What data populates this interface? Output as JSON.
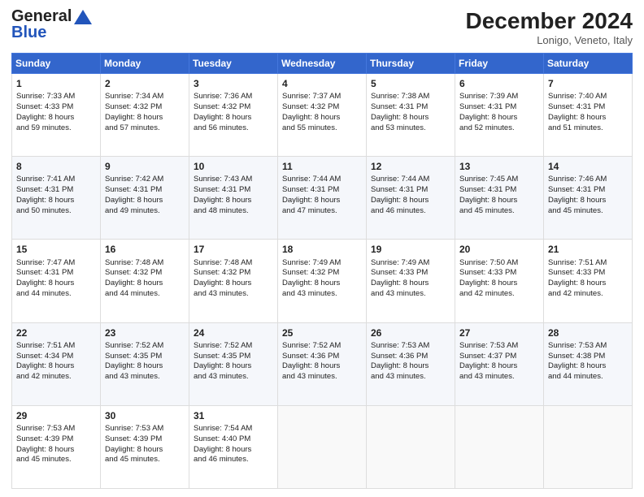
{
  "header": {
    "logo_line1": "General",
    "logo_line2": "Blue",
    "month": "December 2024",
    "location": "Lonigo, Veneto, Italy"
  },
  "weekdays": [
    "Sunday",
    "Monday",
    "Tuesday",
    "Wednesday",
    "Thursday",
    "Friday",
    "Saturday"
  ],
  "weeks": [
    [
      {
        "day": "1",
        "lines": [
          "Sunrise: 7:33 AM",
          "Sunset: 4:33 PM",
          "Daylight: 8 hours",
          "and 59 minutes."
        ]
      },
      {
        "day": "2",
        "lines": [
          "Sunrise: 7:34 AM",
          "Sunset: 4:32 PM",
          "Daylight: 8 hours",
          "and 57 minutes."
        ]
      },
      {
        "day": "3",
        "lines": [
          "Sunrise: 7:36 AM",
          "Sunset: 4:32 PM",
          "Daylight: 8 hours",
          "and 56 minutes."
        ]
      },
      {
        "day": "4",
        "lines": [
          "Sunrise: 7:37 AM",
          "Sunset: 4:32 PM",
          "Daylight: 8 hours",
          "and 55 minutes."
        ]
      },
      {
        "day": "5",
        "lines": [
          "Sunrise: 7:38 AM",
          "Sunset: 4:31 PM",
          "Daylight: 8 hours",
          "and 53 minutes."
        ]
      },
      {
        "day": "6",
        "lines": [
          "Sunrise: 7:39 AM",
          "Sunset: 4:31 PM",
          "Daylight: 8 hours",
          "and 52 minutes."
        ]
      },
      {
        "day": "7",
        "lines": [
          "Sunrise: 7:40 AM",
          "Sunset: 4:31 PM",
          "Daylight: 8 hours",
          "and 51 minutes."
        ]
      }
    ],
    [
      {
        "day": "8",
        "lines": [
          "Sunrise: 7:41 AM",
          "Sunset: 4:31 PM",
          "Daylight: 8 hours",
          "and 50 minutes."
        ]
      },
      {
        "day": "9",
        "lines": [
          "Sunrise: 7:42 AM",
          "Sunset: 4:31 PM",
          "Daylight: 8 hours",
          "and 49 minutes."
        ]
      },
      {
        "day": "10",
        "lines": [
          "Sunrise: 7:43 AM",
          "Sunset: 4:31 PM",
          "Daylight: 8 hours",
          "and 48 minutes."
        ]
      },
      {
        "day": "11",
        "lines": [
          "Sunrise: 7:44 AM",
          "Sunset: 4:31 PM",
          "Daylight: 8 hours",
          "and 47 minutes."
        ]
      },
      {
        "day": "12",
        "lines": [
          "Sunrise: 7:44 AM",
          "Sunset: 4:31 PM",
          "Daylight: 8 hours",
          "and 46 minutes."
        ]
      },
      {
        "day": "13",
        "lines": [
          "Sunrise: 7:45 AM",
          "Sunset: 4:31 PM",
          "Daylight: 8 hours",
          "and 45 minutes."
        ]
      },
      {
        "day": "14",
        "lines": [
          "Sunrise: 7:46 AM",
          "Sunset: 4:31 PM",
          "Daylight: 8 hours",
          "and 45 minutes."
        ]
      }
    ],
    [
      {
        "day": "15",
        "lines": [
          "Sunrise: 7:47 AM",
          "Sunset: 4:31 PM",
          "Daylight: 8 hours",
          "and 44 minutes."
        ]
      },
      {
        "day": "16",
        "lines": [
          "Sunrise: 7:48 AM",
          "Sunset: 4:32 PM",
          "Daylight: 8 hours",
          "and 44 minutes."
        ]
      },
      {
        "day": "17",
        "lines": [
          "Sunrise: 7:48 AM",
          "Sunset: 4:32 PM",
          "Daylight: 8 hours",
          "and 43 minutes."
        ]
      },
      {
        "day": "18",
        "lines": [
          "Sunrise: 7:49 AM",
          "Sunset: 4:32 PM",
          "Daylight: 8 hours",
          "and 43 minutes."
        ]
      },
      {
        "day": "19",
        "lines": [
          "Sunrise: 7:49 AM",
          "Sunset: 4:33 PM",
          "Daylight: 8 hours",
          "and 43 minutes."
        ]
      },
      {
        "day": "20",
        "lines": [
          "Sunrise: 7:50 AM",
          "Sunset: 4:33 PM",
          "Daylight: 8 hours",
          "and 42 minutes."
        ]
      },
      {
        "day": "21",
        "lines": [
          "Sunrise: 7:51 AM",
          "Sunset: 4:33 PM",
          "Daylight: 8 hours",
          "and 42 minutes."
        ]
      }
    ],
    [
      {
        "day": "22",
        "lines": [
          "Sunrise: 7:51 AM",
          "Sunset: 4:34 PM",
          "Daylight: 8 hours",
          "and 42 minutes."
        ]
      },
      {
        "day": "23",
        "lines": [
          "Sunrise: 7:52 AM",
          "Sunset: 4:35 PM",
          "Daylight: 8 hours",
          "and 43 minutes."
        ]
      },
      {
        "day": "24",
        "lines": [
          "Sunrise: 7:52 AM",
          "Sunset: 4:35 PM",
          "Daylight: 8 hours",
          "and 43 minutes."
        ]
      },
      {
        "day": "25",
        "lines": [
          "Sunrise: 7:52 AM",
          "Sunset: 4:36 PM",
          "Daylight: 8 hours",
          "and 43 minutes."
        ]
      },
      {
        "day": "26",
        "lines": [
          "Sunrise: 7:53 AM",
          "Sunset: 4:36 PM",
          "Daylight: 8 hours",
          "and 43 minutes."
        ]
      },
      {
        "day": "27",
        "lines": [
          "Sunrise: 7:53 AM",
          "Sunset: 4:37 PM",
          "Daylight: 8 hours",
          "and 43 minutes."
        ]
      },
      {
        "day": "28",
        "lines": [
          "Sunrise: 7:53 AM",
          "Sunset: 4:38 PM",
          "Daylight: 8 hours",
          "and 44 minutes."
        ]
      }
    ],
    [
      {
        "day": "29",
        "lines": [
          "Sunrise: 7:53 AM",
          "Sunset: 4:39 PM",
          "Daylight: 8 hours",
          "and 45 minutes."
        ]
      },
      {
        "day": "30",
        "lines": [
          "Sunrise: 7:53 AM",
          "Sunset: 4:39 PM",
          "Daylight: 8 hours",
          "and 45 minutes."
        ]
      },
      {
        "day": "31",
        "lines": [
          "Sunrise: 7:54 AM",
          "Sunset: 4:40 PM",
          "Daylight: 8 hours",
          "and 46 minutes."
        ]
      },
      null,
      null,
      null,
      null
    ]
  ]
}
